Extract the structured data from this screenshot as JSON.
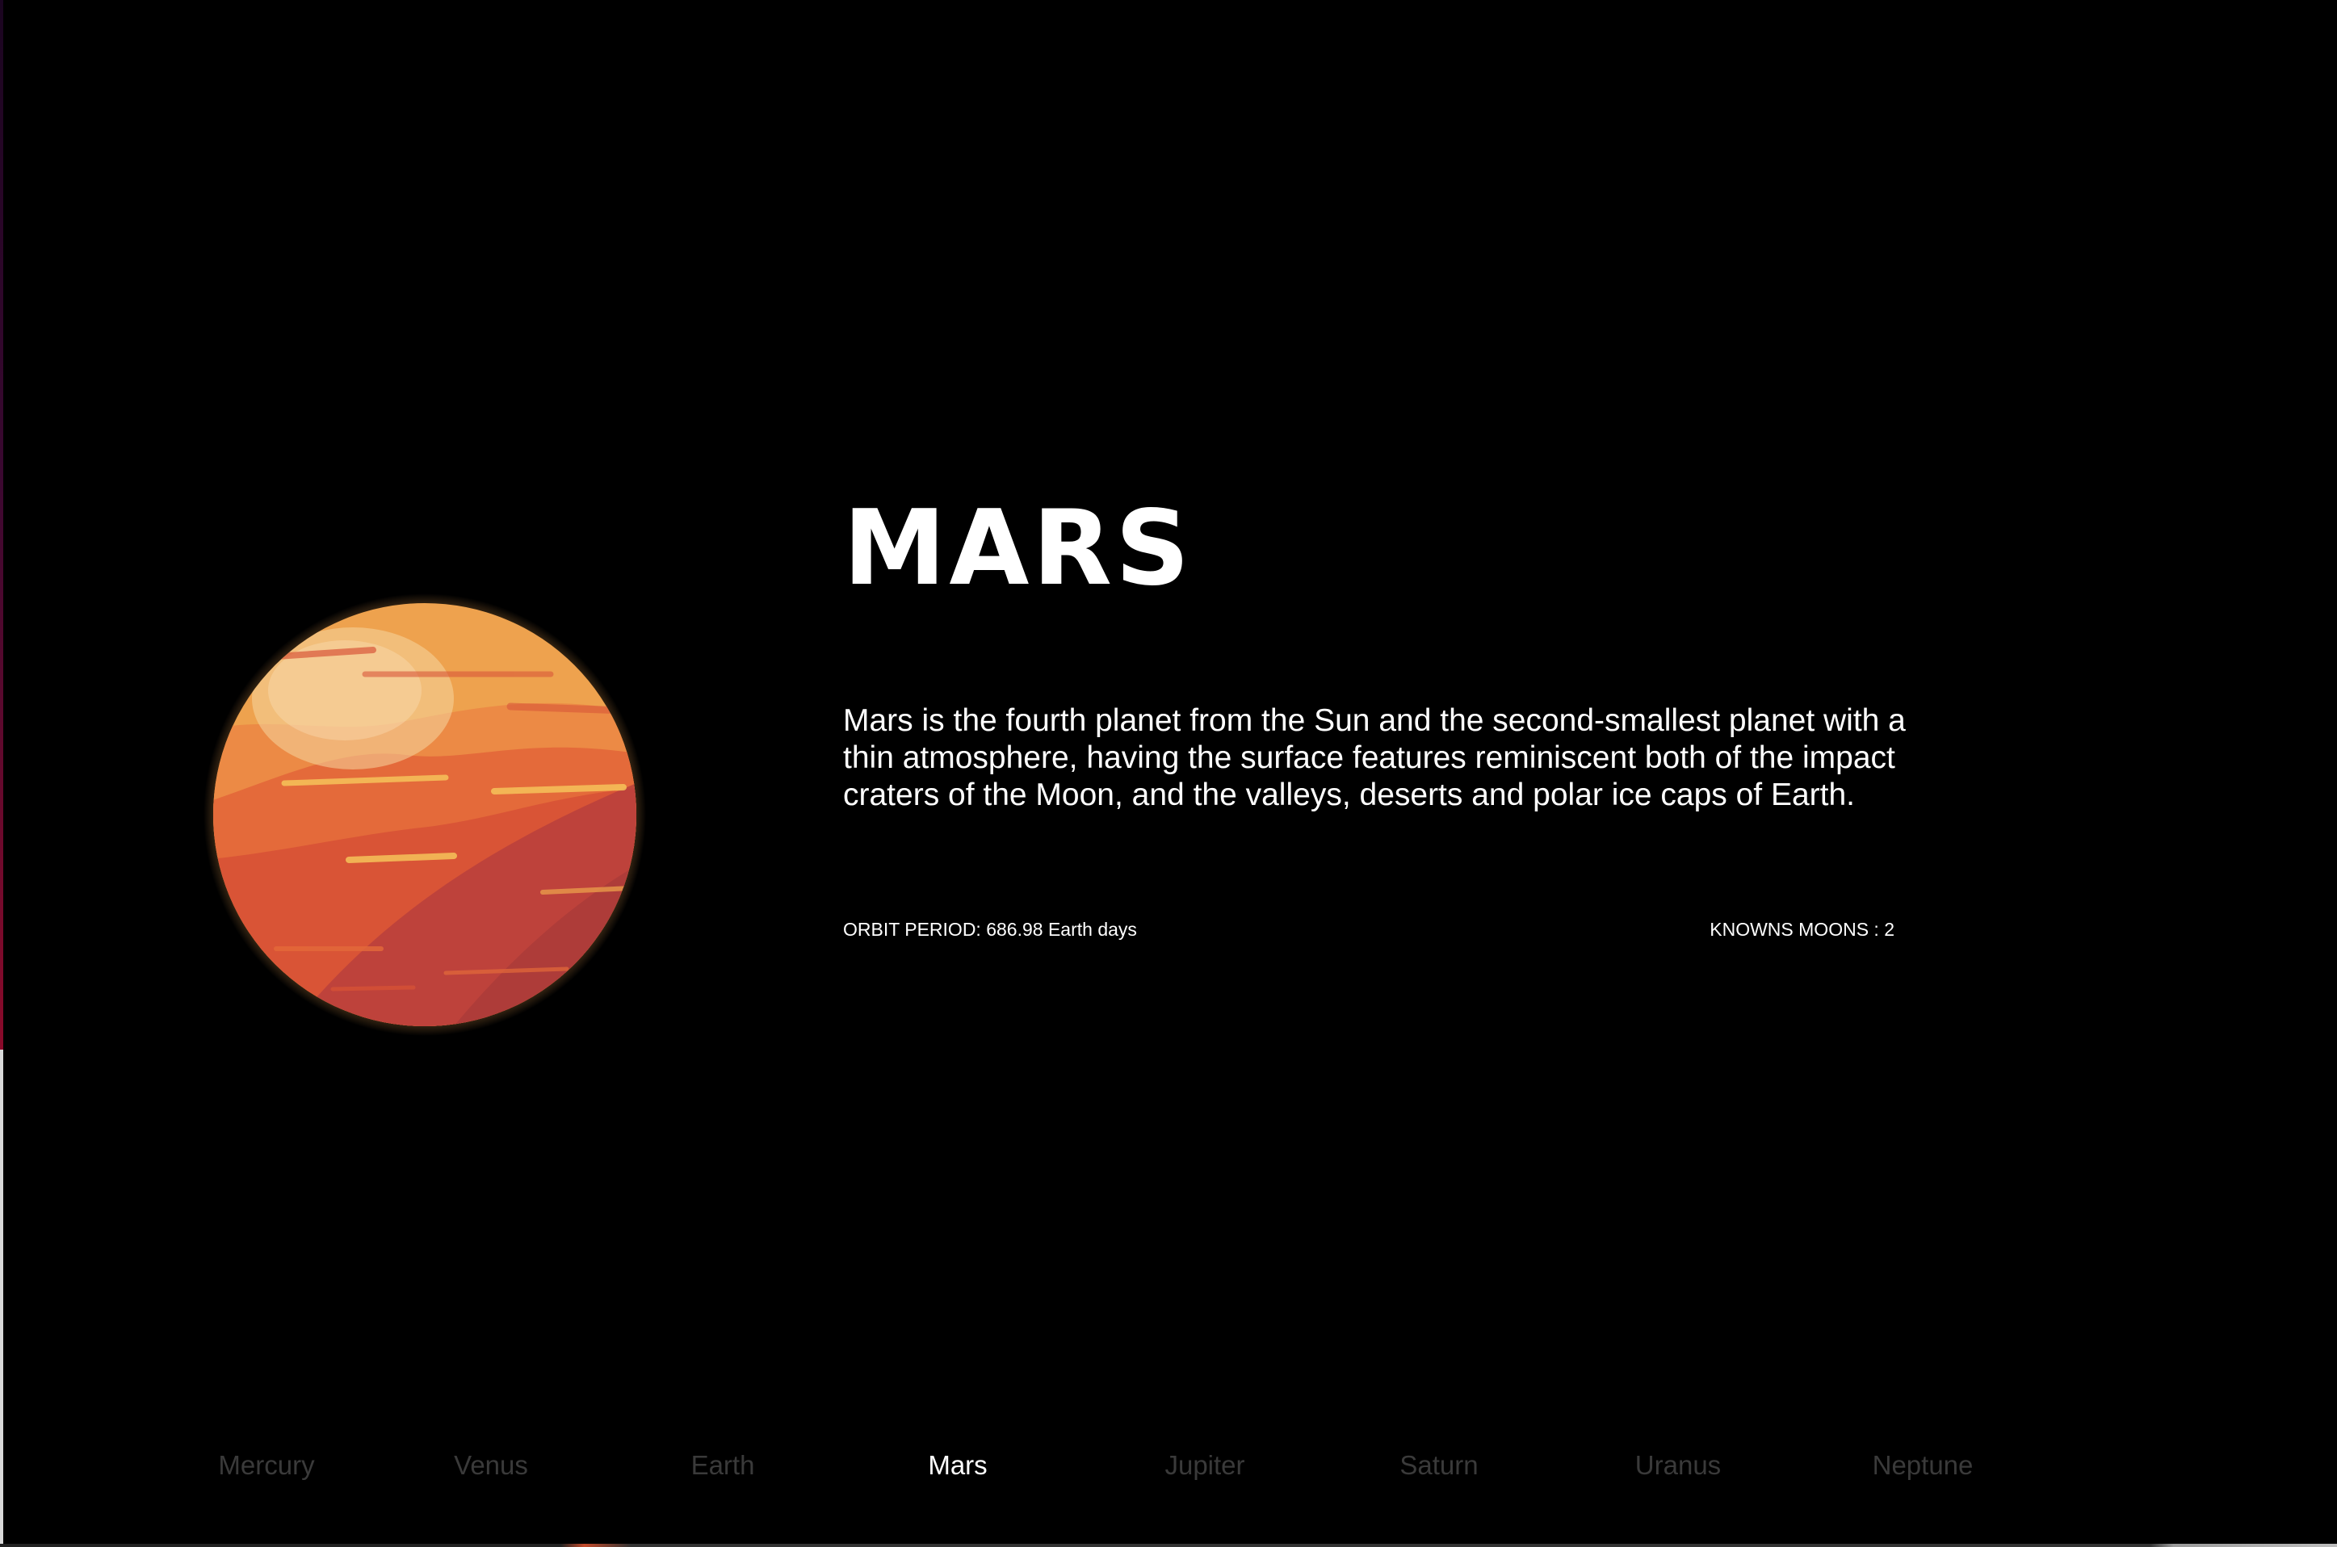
{
  "planet": {
    "name": "MARS",
    "description": "Mars is the fourth planet from the Sun and the second-smallest planet with a thin atmosphere, having the surface features reminiscent both of the impact craters of the Moon, and the valleys, deserts and polar ice caps of Earth.",
    "orbit_period": "ORBIT PERIOD: 686.98 Earth days",
    "known_moons": "KNOWNS MOONS : 2",
    "image_icon": "mars-planet-illustration"
  },
  "nav": {
    "items": [
      {
        "label": "Mercury",
        "active": false
      },
      {
        "label": "Venus",
        "active": false
      },
      {
        "label": "Earth",
        "active": false
      },
      {
        "label": "Mars",
        "active": true
      },
      {
        "label": "Jupiter",
        "active": false
      },
      {
        "label": "Saturn",
        "active": false
      },
      {
        "label": "Uranus",
        "active": false
      },
      {
        "label": "Neptune",
        "active": false
      }
    ]
  },
  "colors": {
    "background": "#000000",
    "text": "#ffffff",
    "nav_inactive": "#3a3a3a",
    "nav_active": "#ffffff",
    "planet_light": "#f2b55e",
    "planet_mid": "#e46a3a",
    "planet_dark": "#b9403c"
  }
}
